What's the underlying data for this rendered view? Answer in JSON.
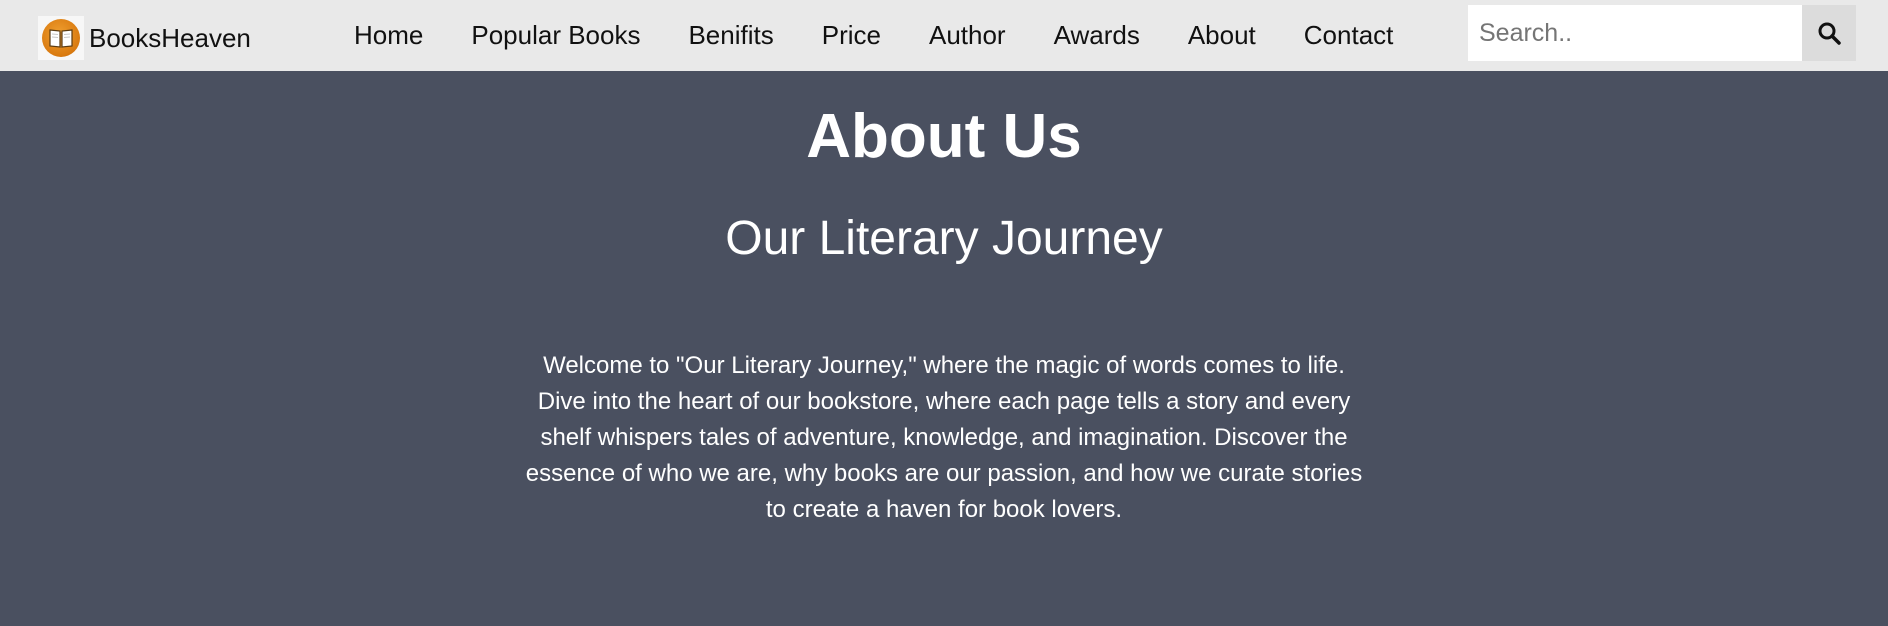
{
  "header": {
    "brand_name": "BooksHeaven",
    "logo_icon": "open-book-icon",
    "nav": [
      "Home",
      "Popular Books",
      "Benifits",
      "Price",
      "Author",
      "Awards",
      "About",
      "Contact"
    ],
    "search": {
      "placeholder": "Search..",
      "value": "",
      "button_icon": "search-icon"
    }
  },
  "about": {
    "title": "About Us",
    "subtitle": "Our Literary Journey",
    "body": "Welcome to \"Our Literary Journey,\" where the magic of words comes to life. Dive into the heart of our bookstore, where each page tells a story and every shelf whispers tales of adventure, knowledge, and imagination. Discover the essence of who we are, why books are our passion, and how we curate stories to create a haven for book lovers."
  },
  "colors": {
    "navbar_bg": "#e9e9e9",
    "page_bg": "#4a5060",
    "text_light": "#ffffff",
    "logo_orange": "#d97a10"
  }
}
